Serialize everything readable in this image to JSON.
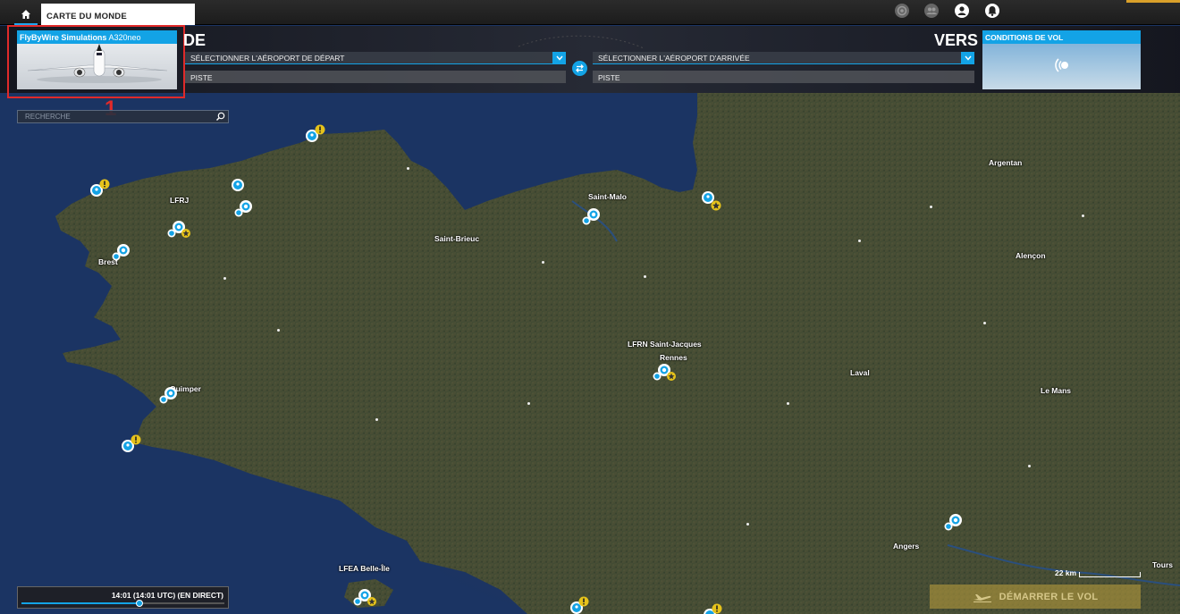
{
  "topbar": {
    "home_icon": "home-icon",
    "breadcrumb": "CARTE DU MONDE",
    "icons": [
      "settings-icon",
      "community-icon",
      "profile-icon",
      "notifications-icon"
    ]
  },
  "aircraft": {
    "brand": "FlyByWire Simulations",
    "model": "A320neo"
  },
  "callout_number": "1",
  "departure": {
    "label": "DE",
    "select": "SÉLECTIONNER L'AÉROPORT DE DÉPART",
    "runway": "PISTE"
  },
  "arrival": {
    "label": "VERS",
    "select": "SÉLECTIONNER L'AÉROPORT D'ARRIVÉE",
    "runway": "PISTE"
  },
  "weather": {
    "title": "CONDITIONS DE VOL"
  },
  "search": {
    "placeholder": "RECHERCHE"
  },
  "places": {
    "argentan": "Argentan",
    "lfrj": "LFRJ",
    "saint_malo": "Saint-Malo",
    "saint_brieuc": "Saint-Brieuc",
    "brest": "Brest",
    "alencon": "Alençon",
    "lfrn": "LFRN Saint-Jacques",
    "rennes": "Rennes",
    "laval": "Laval",
    "quimper": "Quimper",
    "le_mans": "Le Mans",
    "angers": "Angers",
    "tours": "Tours",
    "lfea": "LFEA Belle-Île"
  },
  "time": {
    "label": "14:01 (14:01 UTC) (EN DIRECT)",
    "progress": 0.58
  },
  "scale": "22 km",
  "start_button": "DÉMARRER LE VOL",
  "colors": {
    "accent": "#13a3e6",
    "highlight": "#e02a2a",
    "warning": "#e5c21b"
  }
}
